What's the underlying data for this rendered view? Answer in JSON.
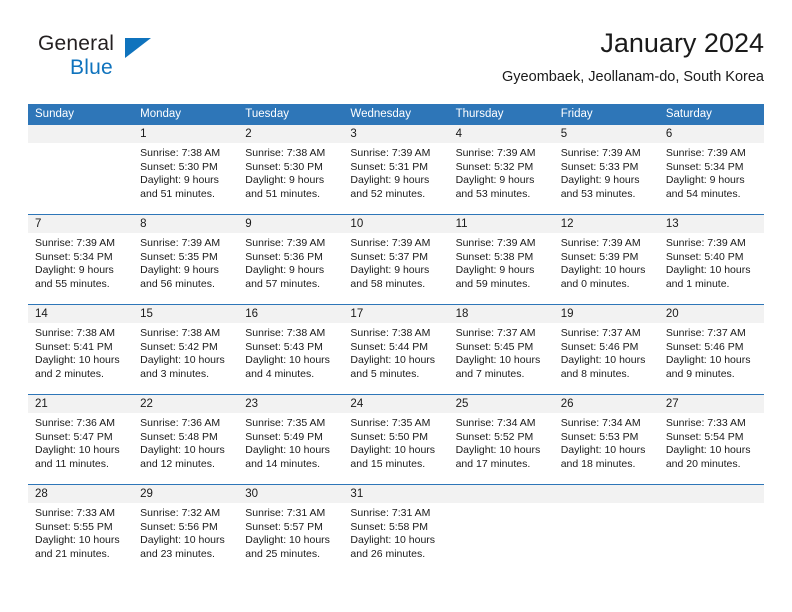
{
  "logo": {
    "word_one": "General",
    "word_two": "Blue",
    "triangle_color": "#0f73bd",
    "icon": "general-blue-logo"
  },
  "header": {
    "title": "January 2024",
    "subtitle": "Gyeombaek, Jeollanam-do, South Korea"
  },
  "colors": {
    "header_blue": "#2e76b8",
    "day_band_gray": "#f2f2f2",
    "text": "#1a1a1a",
    "logo_blue": "#0f73bd"
  },
  "weekdays": [
    "Sunday",
    "Monday",
    "Tuesday",
    "Wednesday",
    "Thursday",
    "Friday",
    "Saturday"
  ],
  "weeks": [
    [
      {
        "day": "",
        "sunrise": "",
        "sunset": "",
        "daylight1": "",
        "daylight2": ""
      },
      {
        "day": "1",
        "sunrise": "Sunrise: 7:38 AM",
        "sunset": "Sunset: 5:30 PM",
        "daylight1": "Daylight: 9 hours",
        "daylight2": "and 51 minutes."
      },
      {
        "day": "2",
        "sunrise": "Sunrise: 7:38 AM",
        "sunset": "Sunset: 5:30 PM",
        "daylight1": "Daylight: 9 hours",
        "daylight2": "and 51 minutes."
      },
      {
        "day": "3",
        "sunrise": "Sunrise: 7:39 AM",
        "sunset": "Sunset: 5:31 PM",
        "daylight1": "Daylight: 9 hours",
        "daylight2": "and 52 minutes."
      },
      {
        "day": "4",
        "sunrise": "Sunrise: 7:39 AM",
        "sunset": "Sunset: 5:32 PM",
        "daylight1": "Daylight: 9 hours",
        "daylight2": "and 53 minutes."
      },
      {
        "day": "5",
        "sunrise": "Sunrise: 7:39 AM",
        "sunset": "Sunset: 5:33 PM",
        "daylight1": "Daylight: 9 hours",
        "daylight2": "and 53 minutes."
      },
      {
        "day": "6",
        "sunrise": "Sunrise: 7:39 AM",
        "sunset": "Sunset: 5:34 PM",
        "daylight1": "Daylight: 9 hours",
        "daylight2": "and 54 minutes."
      }
    ],
    [
      {
        "day": "7",
        "sunrise": "Sunrise: 7:39 AM",
        "sunset": "Sunset: 5:34 PM",
        "daylight1": "Daylight: 9 hours",
        "daylight2": "and 55 minutes."
      },
      {
        "day": "8",
        "sunrise": "Sunrise: 7:39 AM",
        "sunset": "Sunset: 5:35 PM",
        "daylight1": "Daylight: 9 hours",
        "daylight2": "and 56 minutes."
      },
      {
        "day": "9",
        "sunrise": "Sunrise: 7:39 AM",
        "sunset": "Sunset: 5:36 PM",
        "daylight1": "Daylight: 9 hours",
        "daylight2": "and 57 minutes."
      },
      {
        "day": "10",
        "sunrise": "Sunrise: 7:39 AM",
        "sunset": "Sunset: 5:37 PM",
        "daylight1": "Daylight: 9 hours",
        "daylight2": "and 58 minutes."
      },
      {
        "day": "11",
        "sunrise": "Sunrise: 7:39 AM",
        "sunset": "Sunset: 5:38 PM",
        "daylight1": "Daylight: 9 hours",
        "daylight2": "and 59 minutes."
      },
      {
        "day": "12",
        "sunrise": "Sunrise: 7:39 AM",
        "sunset": "Sunset: 5:39 PM",
        "daylight1": "Daylight: 10 hours",
        "daylight2": "and 0 minutes."
      },
      {
        "day": "13",
        "sunrise": "Sunrise: 7:39 AM",
        "sunset": "Sunset: 5:40 PM",
        "daylight1": "Daylight: 10 hours",
        "daylight2": "and 1 minute."
      }
    ],
    [
      {
        "day": "14",
        "sunrise": "Sunrise: 7:38 AM",
        "sunset": "Sunset: 5:41 PM",
        "daylight1": "Daylight: 10 hours",
        "daylight2": "and 2 minutes."
      },
      {
        "day": "15",
        "sunrise": "Sunrise: 7:38 AM",
        "sunset": "Sunset: 5:42 PM",
        "daylight1": "Daylight: 10 hours",
        "daylight2": "and 3 minutes."
      },
      {
        "day": "16",
        "sunrise": "Sunrise: 7:38 AM",
        "sunset": "Sunset: 5:43 PM",
        "daylight1": "Daylight: 10 hours",
        "daylight2": "and 4 minutes."
      },
      {
        "day": "17",
        "sunrise": "Sunrise: 7:38 AM",
        "sunset": "Sunset: 5:44 PM",
        "daylight1": "Daylight: 10 hours",
        "daylight2": "and 5 minutes."
      },
      {
        "day": "18",
        "sunrise": "Sunrise: 7:37 AM",
        "sunset": "Sunset: 5:45 PM",
        "daylight1": "Daylight: 10 hours",
        "daylight2": "and 7 minutes."
      },
      {
        "day": "19",
        "sunrise": "Sunrise: 7:37 AM",
        "sunset": "Sunset: 5:46 PM",
        "daylight1": "Daylight: 10 hours",
        "daylight2": "and 8 minutes."
      },
      {
        "day": "20",
        "sunrise": "Sunrise: 7:37 AM",
        "sunset": "Sunset: 5:46 PM",
        "daylight1": "Daylight: 10 hours",
        "daylight2": "and 9 minutes."
      }
    ],
    [
      {
        "day": "21",
        "sunrise": "Sunrise: 7:36 AM",
        "sunset": "Sunset: 5:47 PM",
        "daylight1": "Daylight: 10 hours",
        "daylight2": "and 11 minutes."
      },
      {
        "day": "22",
        "sunrise": "Sunrise: 7:36 AM",
        "sunset": "Sunset: 5:48 PM",
        "daylight1": "Daylight: 10 hours",
        "daylight2": "and 12 minutes."
      },
      {
        "day": "23",
        "sunrise": "Sunrise: 7:35 AM",
        "sunset": "Sunset: 5:49 PM",
        "daylight1": "Daylight: 10 hours",
        "daylight2": "and 14 minutes."
      },
      {
        "day": "24",
        "sunrise": "Sunrise: 7:35 AM",
        "sunset": "Sunset: 5:50 PM",
        "daylight1": "Daylight: 10 hours",
        "daylight2": "and 15 minutes."
      },
      {
        "day": "25",
        "sunrise": "Sunrise: 7:34 AM",
        "sunset": "Sunset: 5:52 PM",
        "daylight1": "Daylight: 10 hours",
        "daylight2": "and 17 minutes."
      },
      {
        "day": "26",
        "sunrise": "Sunrise: 7:34 AM",
        "sunset": "Sunset: 5:53 PM",
        "daylight1": "Daylight: 10 hours",
        "daylight2": "and 18 minutes."
      },
      {
        "day": "27",
        "sunrise": "Sunrise: 7:33 AM",
        "sunset": "Sunset: 5:54 PM",
        "daylight1": "Daylight: 10 hours",
        "daylight2": "and 20 minutes."
      }
    ],
    [
      {
        "day": "28",
        "sunrise": "Sunrise: 7:33 AM",
        "sunset": "Sunset: 5:55 PM",
        "daylight1": "Daylight: 10 hours",
        "daylight2": "and 21 minutes."
      },
      {
        "day": "29",
        "sunrise": "Sunrise: 7:32 AM",
        "sunset": "Sunset: 5:56 PM",
        "daylight1": "Daylight: 10 hours",
        "daylight2": "and 23 minutes."
      },
      {
        "day": "30",
        "sunrise": "Sunrise: 7:31 AM",
        "sunset": "Sunset: 5:57 PM",
        "daylight1": "Daylight: 10 hours",
        "daylight2": "and 25 minutes."
      },
      {
        "day": "31",
        "sunrise": "Sunrise: 7:31 AM",
        "sunset": "Sunset: 5:58 PM",
        "daylight1": "Daylight: 10 hours",
        "daylight2": "and 26 minutes."
      },
      {
        "day": "",
        "sunrise": "",
        "sunset": "",
        "daylight1": "",
        "daylight2": ""
      },
      {
        "day": "",
        "sunrise": "",
        "sunset": "",
        "daylight1": "",
        "daylight2": ""
      },
      {
        "day": "",
        "sunrise": "",
        "sunset": "",
        "daylight1": "",
        "daylight2": ""
      }
    ]
  ]
}
